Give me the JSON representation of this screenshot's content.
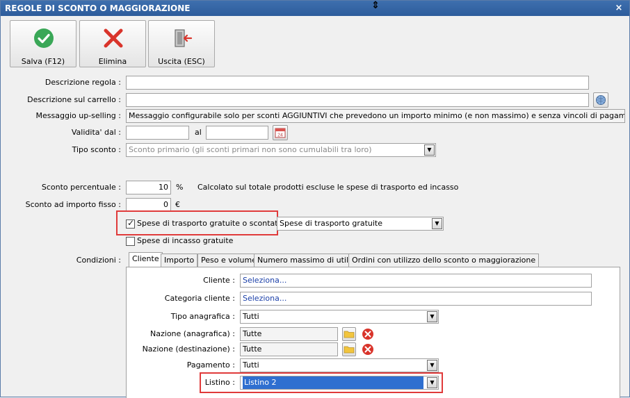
{
  "window": {
    "title": "REGOLE DI SCONTO O MAGGIORAZIONE",
    "close_glyph": "×",
    "cursor_glyph": "⇕"
  },
  "toolbar": {
    "save_label": "Salva (F12)",
    "delete_label": "Elimina",
    "exit_label": "Uscita (ESC)"
  },
  "form": {
    "descrizione_regola_label": "Descrizione regola :",
    "descrizione_regola_value": "",
    "descrizione_carrello_label": "Descrizione sul carrello :",
    "descrizione_carrello_value": "",
    "messaggio_label": "Messaggio up-selling :",
    "messaggio_value": "Messaggio configurabile solo per sconti AGGIUNTIVI che prevedono un importo minimo (e non massimo) e senza vincoli di pagamento, peso o volume",
    "validita_label": "Validita' dal :",
    "validita_dal_value": "",
    "validita_al_label": "al",
    "validita_al_value": "",
    "calendar_day": "24",
    "tipo_sconto_label": "Tipo sconto :",
    "tipo_sconto_value": "Sconto primario (gli sconti primari non sono cumulabili tra loro)",
    "sconto_percentuale_label": "Sconto percentuale :",
    "sconto_percentuale_value": "10",
    "sconto_percentuale_unit": "%",
    "sconto_percentuale_note": "Calcolato sul totale prodotti escluse le spese di trasporto ed incasso",
    "sconto_importo_label": "Sconto ad importo fisso :",
    "sconto_importo_value": "0",
    "sconto_importo_unit": "€",
    "spese_trasporto_label": "Spese di trasporto gratuite o scontate",
    "spese_trasporto_checked": true,
    "spese_trasporto_option": "Spese di trasporto gratuite",
    "spese_incasso_label": "Spese di incasso gratuite",
    "spese_incasso_checked": false,
    "condizioni_label": "Condizioni :"
  },
  "tabs": [
    "Cliente",
    "Importo",
    "Peso e volume",
    "Numero massimo di utilizzi",
    "Ordini con utilizzo dello sconto o maggiorazione"
  ],
  "cliente_tab": {
    "cliente_label": "Cliente :",
    "cliente_value": "Seleziona...",
    "categoria_label": "Categoria cliente :",
    "categoria_value": "Seleziona...",
    "tipo_anagrafica_label": "Tipo anagrafica :",
    "tipo_anagrafica_value": "Tutti",
    "nazione_anagrafica_label": "Nazione (anagrafica) :",
    "nazione_anagrafica_value": "Tutte",
    "nazione_destinazione_label": "Nazione (destinazione) :",
    "nazione_destinazione_value": "Tutte",
    "pagamento_label": "Pagamento :",
    "pagamento_value": "Tutti",
    "listino_label": "Listino :",
    "listino_value": "Listino 2"
  },
  "colors": {
    "title_bar": "#2d5c9b",
    "highlight": "#e03a3a",
    "check_green": "#3aa757",
    "delete_red": "#d9342b",
    "selection": "#2f6fd0"
  }
}
